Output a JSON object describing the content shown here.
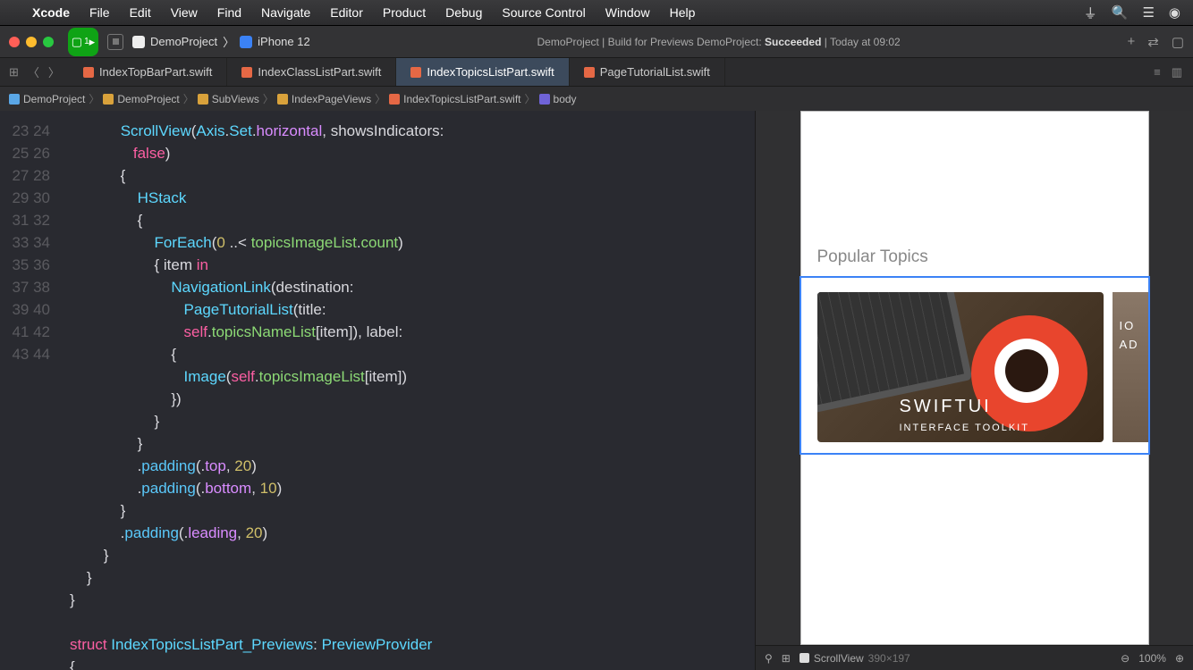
{
  "menubar": {
    "app": "Xcode",
    "items": [
      "File",
      "Edit",
      "View",
      "Find",
      "Navigate",
      "Editor",
      "Product",
      "Debug",
      "Source Control",
      "Window",
      "Help"
    ]
  },
  "toolbar": {
    "run_badge": "1",
    "scheme_name": "DemoProject",
    "device": "iPhone 12",
    "status_prefix": "DemoProject | Build for Previews DemoProject: ",
    "status_result": "Succeeded",
    "status_time": " | Today at 09:02"
  },
  "tabs": [
    {
      "label": "IndexTopBarPart.swift",
      "active": false
    },
    {
      "label": "IndexClassListPart.swift",
      "active": false
    },
    {
      "label": "IndexTopicsListPart.swift",
      "active": true
    },
    {
      "label": "PageTutorialList.swift",
      "active": false
    }
  ],
  "breadcrumb": [
    "DemoProject",
    "DemoProject",
    "SubViews",
    "IndexPageViews",
    "IndexTopicsListPart.swift",
    "body"
  ],
  "code": {
    "lines_start": 23,
    "lines_end": 44
  },
  "preview": {
    "section_title": "Popular Topics",
    "card1_title": "SWIFTUI",
    "card1_subtitle": "INTERFACE TOOLKIT",
    "card2_line1": "IO",
    "card2_line2": "AD",
    "selected_element": "ScrollView",
    "selected_size": "390×197",
    "zoom": "100%"
  }
}
